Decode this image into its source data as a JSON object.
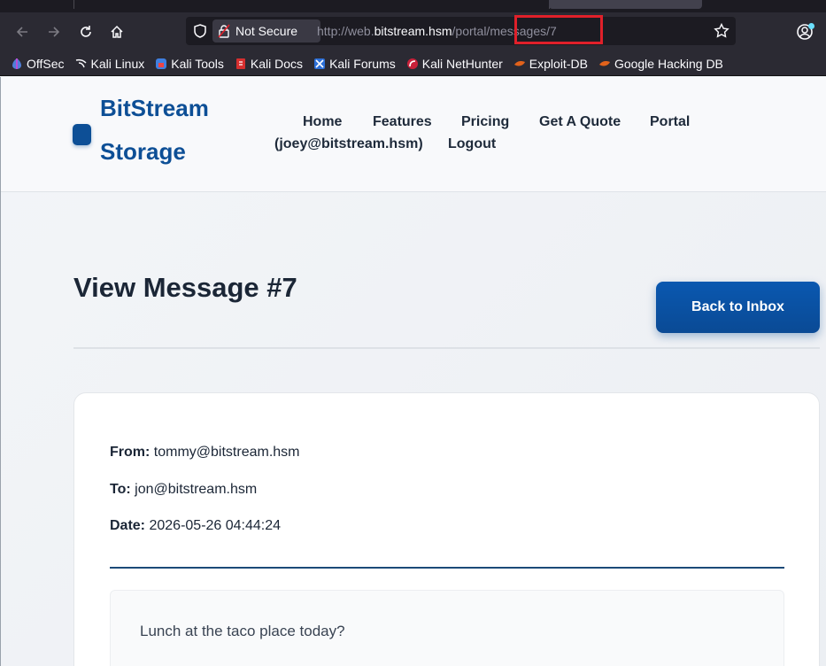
{
  "browser": {
    "security_label": "Not Secure",
    "url_prefix": "http://web.",
    "url_host": "bitstream.hsm",
    "url_path": "/portal/messages/7",
    "bookmarks": [
      {
        "label": "OffSec",
        "icon": "offsec-icon"
      },
      {
        "label": "Kali Linux",
        "icon": "kali-dragon-icon"
      },
      {
        "label": "Kali Tools",
        "icon": "kali-tools-icon"
      },
      {
        "label": "Kali Docs",
        "icon": "kali-docs-icon"
      },
      {
        "label": "Kali Forums",
        "icon": "kali-forums-icon"
      },
      {
        "label": "Kali NetHunter",
        "icon": "nethunter-icon"
      },
      {
        "label": "Exploit-DB",
        "icon": "exploit-db-icon"
      },
      {
        "label": "Google Hacking DB",
        "icon": "ghdb-icon"
      }
    ]
  },
  "site": {
    "logo_line1": "BitStream",
    "logo_line2": "Storage",
    "nav": {
      "home": "Home",
      "features": "Features",
      "pricing": "Pricing",
      "quote": "Get A Quote",
      "portal": "Portal",
      "user": "(joey@bitstream.hsm)",
      "logout": "Logout"
    }
  },
  "message": {
    "title": "View Message #7",
    "back_label": "Back to Inbox",
    "from_label": "From:",
    "from_value": "tommy@bitstream.hsm",
    "to_label": "To:",
    "to_value": "jon@bitstream.hsm",
    "date_label": "Date:",
    "date_value": "2026-05-26 04:44:24",
    "body": "Lunch at the taco place today?"
  },
  "colors": {
    "brand": "#0d4f96",
    "button": "#0a4a95",
    "highlight": "#e0202a"
  }
}
